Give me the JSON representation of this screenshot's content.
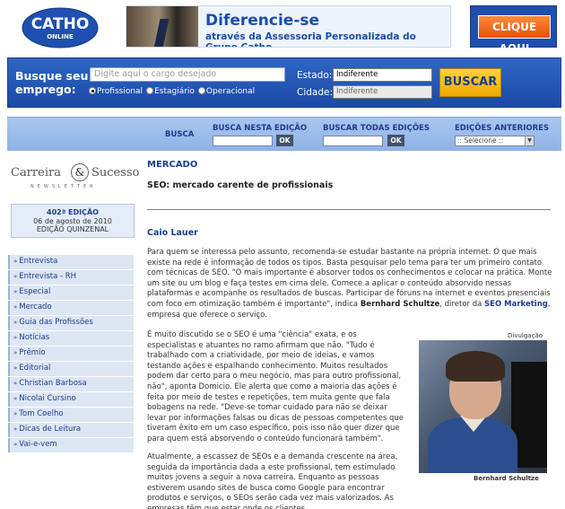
{
  "header": {
    "logo_text": "CATHO",
    "logo_sub": "ONLINE",
    "banner_line1": "Diferencie-se",
    "banner_line2": "através da Assessoria Personalizada do Grupo Catho",
    "cta_label": "CLIQUE AQUI"
  },
  "search": {
    "label_line1": "Busque seu",
    "label_line2": "emprego:",
    "cargo_placeholder": "Digite aqui o cargo desejado",
    "radio_options": [
      "Profissional",
      "Estagiário",
      "Operacional"
    ],
    "radio_selected": "Profissional",
    "estado_label": "Estado:",
    "estado_value": "Indiferente",
    "cidade_label": "Cidade:",
    "cidade_value": "Indiferente",
    "buscar_label": "BUSCAR"
  },
  "edition_search": {
    "busca_label": "BUSCA",
    "nesta_label": "BUSCA NESTA EDIÇÃO",
    "todas_label": "BUSCAR TODAS EDIÇÕES",
    "anteriores_label": "EDIÇÕES ANTERIORES",
    "ok_label": "OK",
    "select_value": ":: Selecione ::"
  },
  "sidebar": {
    "newsletter_word1": "Carreira",
    "newsletter_amp": "&",
    "newsletter_word2": "Sucesso",
    "newsletter_sub": "NEWSLETTER",
    "edition_number": "402ª EDIÇÃO",
    "edition_date": "06 de agosto de 2010",
    "edition_type": "EDIÇÃO QUINZENAL",
    "menu": [
      "Entrevista",
      "Entrevista - RH",
      "Especial",
      "Mercado",
      "Guia das Profissões",
      "Notícias",
      "Prêmio",
      "Editorial",
      "Christian Barbosa",
      "Nicolai Cursino",
      "Tom Coelho",
      "Dicas de Leitura",
      "Vai-e-vem"
    ]
  },
  "article": {
    "section": "MERCADO",
    "headline": "SEO: mercado carente de profissionais",
    "author": "Caio Lauer",
    "p1_text": "Para quem se interessa pelo assunto, recomenda-se estudar bastante na própria internet. O que mais existe na rede é informação de todos os tipos. Basta pesquisar pelo tema para ter um primeiro contato com técnicas de SEO. \"O mais importante é absorver todos os conhecimentos e colocar na prática. Monte um site ou um blog e faça testes em cima dele. Comece a aplicar o conteúdo absorvido nessas plataformas e acompanhe os resultados de buscas. Participar de fóruns na internet e eventos presenciais com foco em otimização também é importante\", indica ",
    "p1_name": "Bernhard Schultze",
    "p1_mid": ", diretor da ",
    "p1_link": "SEO Marketing",
    "p1_end": ", empresa que oferece o serviço.",
    "p2": "É muito discutido se o SEO é uma \"ciência\" exata, e os especialistas e atuantes no ramo afirmam que não. \"Tudo é trabalhado com a criatividade, por meio de ideias, e vamos testando ações e espalhando conhecimento. Muitos resultados podem dar certo para o meu negócio, mas para outro profissional, não\", aponta Domicio. Ele alerta que como a maioria das ações é feita por meio de testes e repetições, tem muita gente que fala bobagens na rede. \"Deve-se tomar cuidado para não se deixar levar por informações falsas ou dicas de pessoas competentes que tiveram êxito em um caso específico, pois isso não quer dizer que para quem está absorvendo o conteúdo funcionará também\".",
    "p3": "Atualmente, a escassez de SEOs e a demanda crescente na área, seguida da importância dada a este profissional, tem estimulado muitos jovens a seguir a nova carreira. Enquanto as pessoas estiverem usando sites de busca como Google para encontrar produtos e serviços, o SEOs serão cada vez mais valorizados. As empresas têm que estar onde os clientes",
    "photo_credit": "Divulgação",
    "photo_caption": "Bernhard Schultze"
  }
}
